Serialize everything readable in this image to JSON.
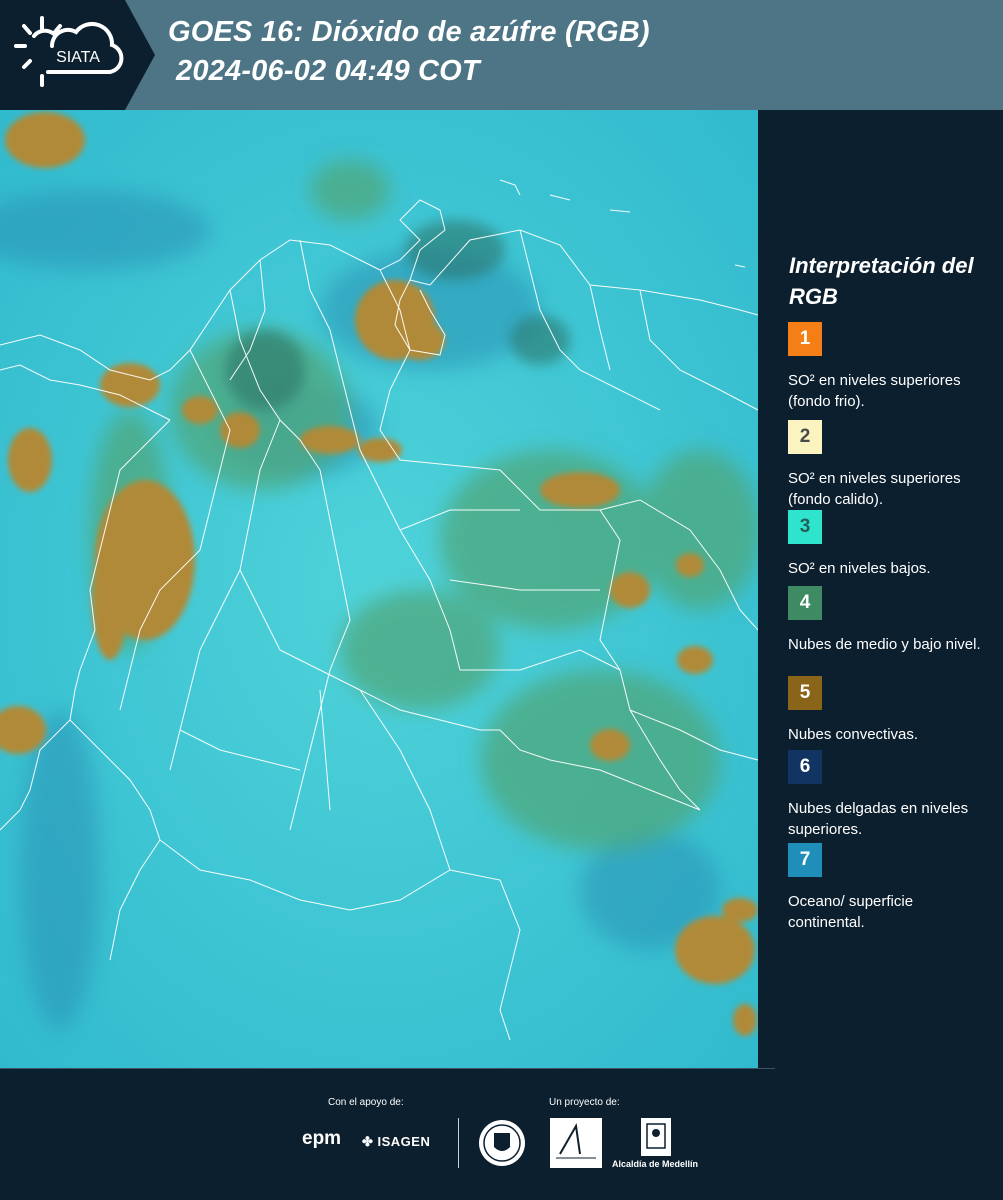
{
  "header": {
    "logo_text": "SIATA",
    "title_line1": "GOES 16: Dióxido de azúfre (RGB)",
    "title_line2": "2024-06-02 04:49 COT"
  },
  "map": {
    "description_colors": {
      "background": "#3fc9d4",
      "convective": "#b08a38",
      "green_cloud": "#53a67a",
      "boundaries": "#ffffff"
    }
  },
  "legend": {
    "title": "Interpretación del RGB",
    "items": [
      {
        "number": "1",
        "label": "SO² en niveles superiores (fondo frio).",
        "color": "#f47f16",
        "text_color": "#ffffff"
      },
      {
        "number": "2",
        "label": "SO² en niveles superiores (fondo calido).",
        "color": "#fbf4c0",
        "text_color": "#4a4a4a"
      },
      {
        "number": "3",
        "label": "SO² en niveles bajos.",
        "color": "#2ee4cd",
        "text_color": "#24605a"
      },
      {
        "number": "4",
        "label": "Nubes de medio y bajo nivel.",
        "color": "#3d8a63",
        "text_color": "#ffffff"
      },
      {
        "number": "5",
        "label": "Nubes convectivas.",
        "color": "#8a6419",
        "text_color": "#ffffff"
      },
      {
        "number": "6",
        "label": "Nubes delgadas en niveles superiores.",
        "color": "#123463",
        "text_color": "#ffffff"
      },
      {
        "number": "7",
        "label": "Oceano/ superficie continental.",
        "color": "#1f8fba",
        "text_color": "#ffffff"
      }
    ]
  },
  "footer": {
    "support_label": "Con el apoyo de:",
    "project_label": "Un proyecto de:",
    "sponsor_1": "epm",
    "sponsor_2": "ISAGEN",
    "partner_1": "Área Metropolitana",
    "partner_2": "Alcaldía de Medellín"
  }
}
